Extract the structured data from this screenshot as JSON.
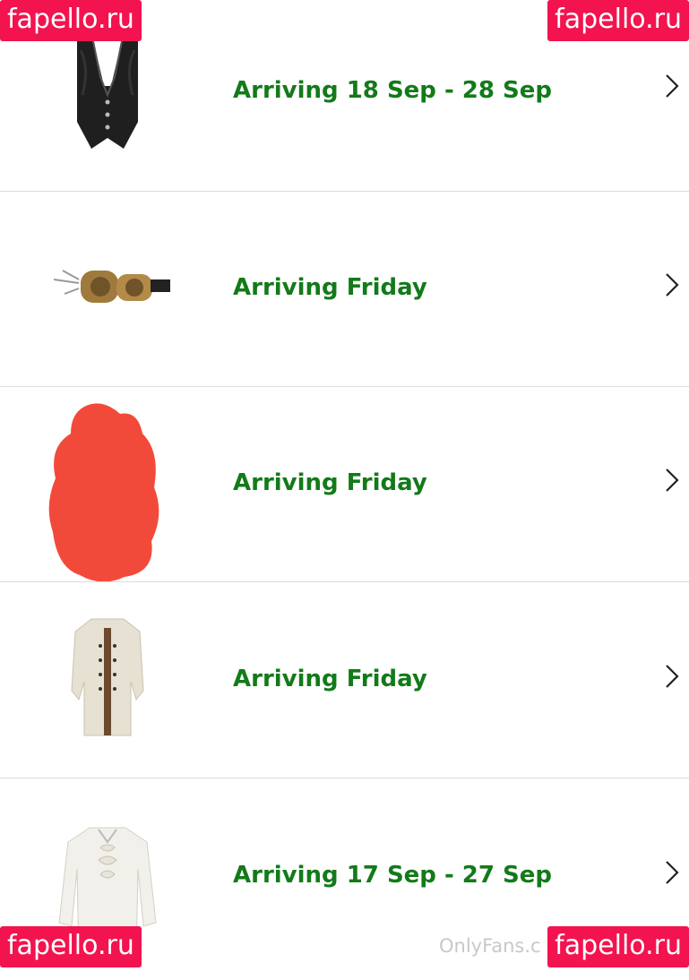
{
  "orders": [
    {
      "status": "Arriving 18 Sep - 28 Sep",
      "item_icon": "black-vest"
    },
    {
      "status": "Arriving Friday",
      "item_icon": "steampunk-goggles"
    },
    {
      "status": "Arriving Friday",
      "item_icon": "redacted-item"
    },
    {
      "status": "Arriving Friday",
      "item_icon": "white-frock-coat"
    },
    {
      "status": "Arriving 17 Sep - 27 Sep",
      "item_icon": "white-ruffled-shirt"
    }
  ],
  "colors": {
    "status": "#137a1a",
    "divider": "#dcdcdc",
    "watermark_bg": "#f2134f",
    "redaction": "#f24a3a"
  },
  "watermarks": {
    "top_left": "fapello.ru",
    "top_right": "fapello.ru",
    "bottom_left": "fapello.ru",
    "bottom_right": "fapello.ru"
  },
  "footer_text": "OnlyFans.c"
}
